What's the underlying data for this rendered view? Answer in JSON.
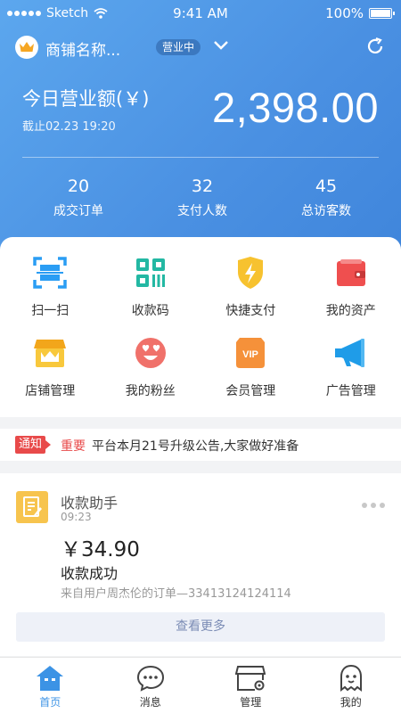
{
  "status_bar": {
    "carrier": "Sketch",
    "time": "9:41 AM",
    "battery": "100%"
  },
  "header": {
    "shop_name": "商铺名称...",
    "shop_status": "营业中",
    "revenue_label": "今日营业额(￥)",
    "revenue_time": "截止02.23 19:20",
    "revenue_amount": "2,398.00",
    "stats": [
      {
        "value": "20",
        "label": "成交订单"
      },
      {
        "value": "32",
        "label": "支付人数"
      },
      {
        "value": "45",
        "label": "总访客数"
      }
    ]
  },
  "features": [
    {
      "label": "扫一扫",
      "icon": "scan-icon"
    },
    {
      "label": "收款码",
      "icon": "qr-code-icon"
    },
    {
      "label": "快捷支付",
      "icon": "lightning-shield-icon"
    },
    {
      "label": "我的资产",
      "icon": "wallet-icon"
    },
    {
      "label": "店铺管理",
      "icon": "store-icon"
    },
    {
      "label": "我的粉丝",
      "icon": "heart-eyes-icon"
    },
    {
      "label": "会员管理",
      "icon": "vip-icon"
    },
    {
      "label": "广告管理",
      "icon": "megaphone-icon"
    }
  ],
  "notice": {
    "tag": "通知",
    "important": "重要",
    "text": "平台本月21号升级公告,大家做好准备"
  },
  "message": {
    "title": "收款助手",
    "time": "09:23",
    "amount": "￥34.90",
    "status": "收款成功",
    "source": "来自用户周杰伦的订单—33413124124114",
    "more_label": "查看更多"
  },
  "tabs": [
    {
      "label": "首页",
      "icon": "home-icon"
    },
    {
      "label": "消息",
      "icon": "chat-icon"
    },
    {
      "label": "管理",
      "icon": "manage-store-icon"
    },
    {
      "label": "我的",
      "icon": "ghost-icon"
    }
  ],
  "colors": {
    "header_gradient_start": "#5ca7ee",
    "header_gradient_end": "#3f85db",
    "accent": "#3c93e5",
    "alert": "#e84a4a"
  }
}
